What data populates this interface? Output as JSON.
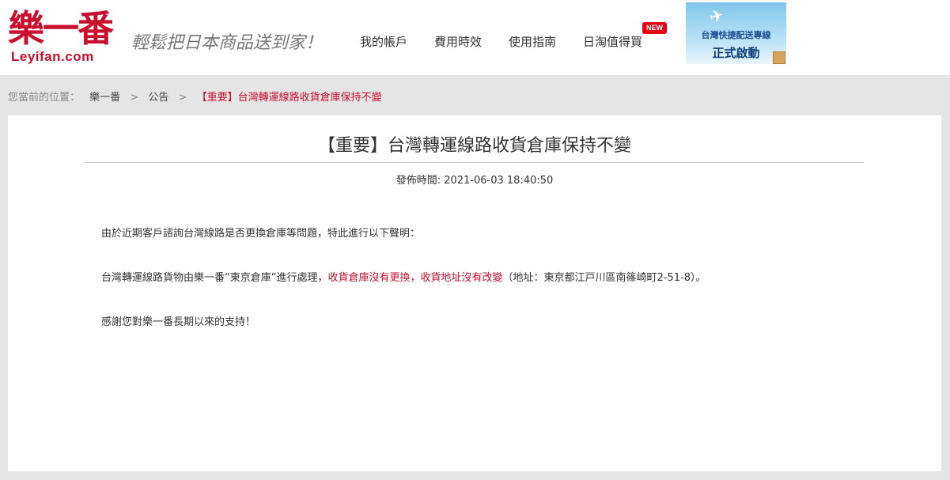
{
  "header": {
    "logo_cn": "樂一番",
    "logo_en": "Leyifan.com",
    "slogan": "輕鬆把日本商品送到家！",
    "nav": [
      "我的帳戶",
      "費用時效",
      "使用指南",
      "日淘值得買"
    ],
    "new_badge": "NEW",
    "banner": {
      "line1": "台灣快捷配送專線",
      "line2": "正式啟動"
    }
  },
  "breadcrumb": {
    "prefix": "您當前的位置：",
    "items": [
      "樂一番",
      "公告"
    ],
    "separator": ">",
    "current": "【重要】台灣轉運線路收貨倉庫保持不變"
  },
  "article": {
    "title": "【重要】台灣轉運線路收貨倉庫保持不變",
    "publish_time": "發佈時間: 2021-06-03 18:40:50",
    "p1": "由於近期客戶諮詢台灣線路是否更換倉庫等問題，特此進行以下聲明：",
    "p2_a": "台灣轉運線路貨物由樂一番“東京倉庫”進行處理，",
    "p2_red1": "收貨倉庫沒有更換",
    "p2_comma": "，",
    "p2_red2": "收貨地址沒有改變",
    "p2_b": "（地址：東京都江戸川區南篠崎町2-51-8）。",
    "p3": "感謝您對樂一番長期以來的支持！"
  },
  "colors": {
    "brand_red": "#c8102e",
    "page_bg": "#e5e5e5"
  }
}
